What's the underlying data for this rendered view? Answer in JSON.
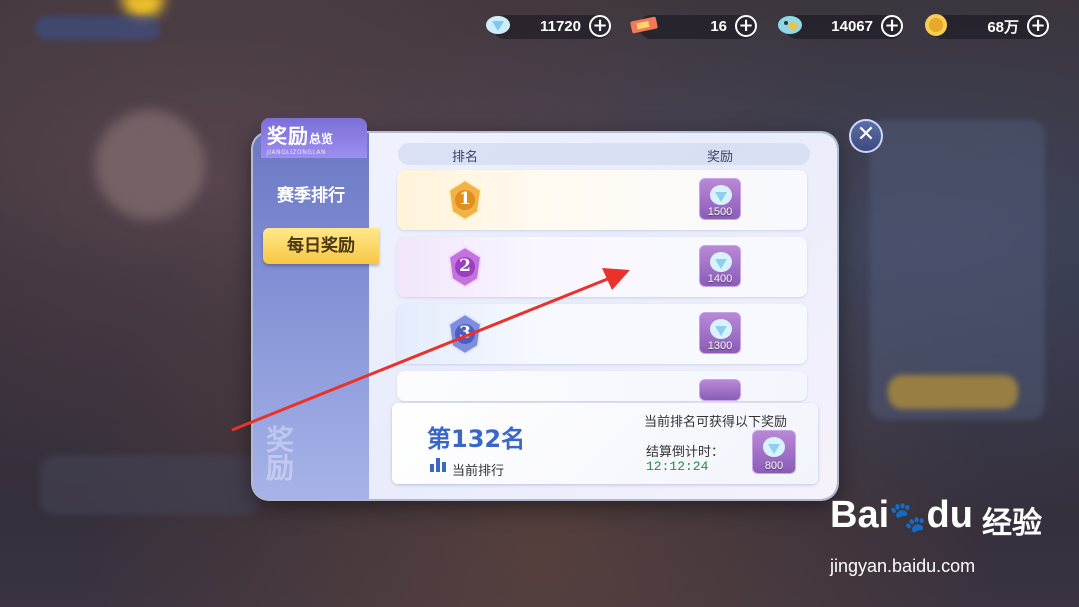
{
  "resources": [
    {
      "icon": "diamond-icon",
      "value": "11720"
    },
    {
      "icon": "ticket-icon",
      "value": "16"
    },
    {
      "icon": "coin-fish-icon",
      "value": "14067"
    },
    {
      "icon": "gold-coin-icon",
      "value": "68万"
    }
  ],
  "panel": {
    "title_main": "奖励",
    "title_sub": "总览",
    "title_pinyin": "JIANGLIZONGLAN",
    "tabs": [
      "赛季排行",
      "每日奖励"
    ],
    "active_tab": "每日奖励",
    "decor_text": "奖励"
  },
  "table": {
    "col_rank": "排名",
    "col_reward": "奖励",
    "rows": [
      {
        "rank": "1",
        "reward": "1500",
        "tint": "#e9a23b"
      },
      {
        "rank": "2",
        "reward": "1400",
        "tint": "#b45ad0"
      },
      {
        "rank": "3",
        "reward": "1300",
        "tint": "#5f6fd0"
      }
    ]
  },
  "my_rank": {
    "rank_text": "第132名",
    "label": "当前排行",
    "note": "当前排名可获得以下奖励",
    "countdown_label": "结算倒计时：",
    "countdown": "12:12:24",
    "reward": "800"
  },
  "watermark": {
    "logo": "Bai",
    "logo2": "du",
    "cn": "经验",
    "url": "jingyan.baidu.com"
  }
}
